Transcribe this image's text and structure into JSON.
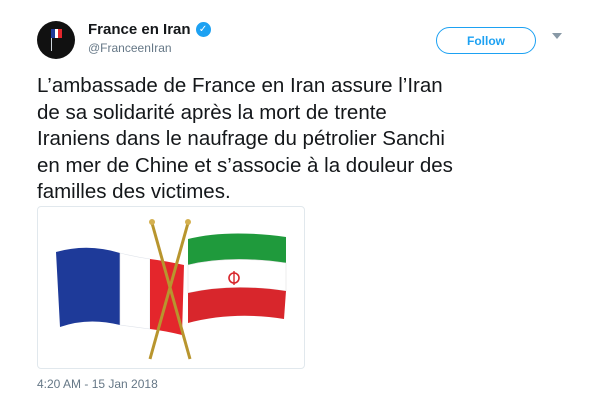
{
  "tweet": {
    "display_name": "France en Iran",
    "handle": "@FranceenIran",
    "verified_icon": "verified-badge-icon",
    "follow_label": "Follow",
    "text_lines": [
      "L’ambassade de France en Iran assure l’Iran",
      "de sa solidarité après la mort de trente",
      "Iraniens dans le naufrage du pétrolier Sanchi",
      "en mer de Chine et s’associe à la douleur des",
      "familles des victimes."
    ],
    "timestamp": "4:20 AM - 15 Jan 2018",
    "media_image": "crossed-france-iran-flags-image"
  },
  "colors": {
    "accent": "#1da1f2",
    "text": "#14171a",
    "muted": "#657786",
    "france_blue": "#1e3a99",
    "france_red": "#e4262c",
    "iran_green": "#1f9a3c",
    "iran_red": "#d8262c"
  }
}
